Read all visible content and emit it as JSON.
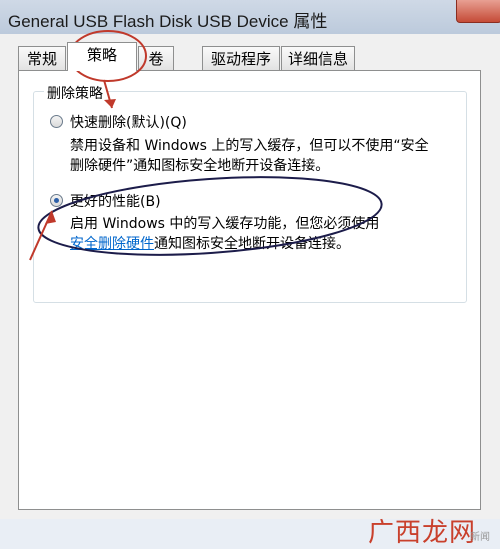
{
  "window": {
    "title": "General USB Flash Disk USB Device 属性"
  },
  "tabs": [
    {
      "label": "常规"
    },
    {
      "label": "策略"
    },
    {
      "label": "卷"
    },
    {
      "label": "驱动程序"
    },
    {
      "label": "详细信息"
    }
  ],
  "active_tab": "策略",
  "removal_policy": {
    "group_label": "删除策略",
    "quick_removal": {
      "label": "快速删除(默认)(Q)",
      "selected": false,
      "desc_line1": "禁用设备和 Windows 上的写入缓存，但可以不使用“安全",
      "desc_line2": "删除硬件”通知图标安全地断开设备连接。"
    },
    "better_performance": {
      "label": "更好的性能(B)",
      "selected": true,
      "desc_line1": "启用 Windows 中的写入缓存功能，但您必须使用",
      "link_text": "安全删除硬件",
      "desc_line2_rest": "通知图标安全地断开设备连接。"
    }
  },
  "watermark": {
    "text": "广西龙网",
    "sub": "新闻"
  },
  "colors": {
    "annotation": "#c0392b",
    "annotation_dark": "#1c1c4a",
    "link": "#0066cc"
  }
}
